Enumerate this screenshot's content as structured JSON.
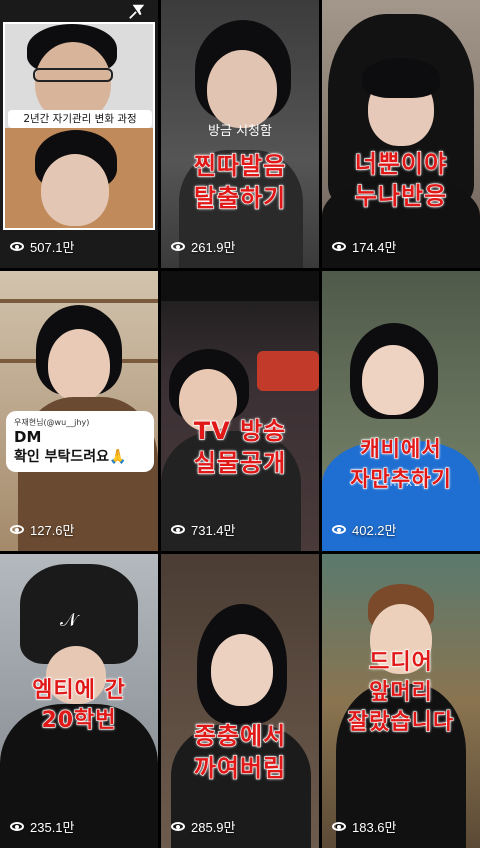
{
  "tiles": [
    {
      "views": "507.1만",
      "label": "2년간 자기관리 변화 과정",
      "bg": "#c9c9c9"
    },
    {
      "views": "261.9만",
      "subtitle": "방금 시청함",
      "line1": "찐따발음",
      "line2": "탈출하기",
      "bg": "#4a4a4a"
    },
    {
      "views": "174.4만",
      "line1": "너뿐이야",
      "line2": "누나반응",
      "bg": "#8c7d70"
    },
    {
      "views": "127.6만",
      "comment_user": "우재현님(@wu__jhy)",
      "comment_line1": "DM",
      "comment_line2": "확인 부탁드려요🙏",
      "bg": "#b7a590"
    },
    {
      "views": "731.4만",
      "line1": "TV 방송",
      "line2": "실물공개",
      "bg": "#3a3034"
    },
    {
      "views": "402.2만",
      "line1": "캐비에서",
      "line2": "자만추하기",
      "bg": "#6b7d63"
    },
    {
      "views": "235.1만",
      "line1": "엠티에 간",
      "line2": "20학번",
      "bg": "#9aa0a6"
    },
    {
      "views": "285.9만",
      "line1": "종충에서",
      "line2": "까여버림",
      "bg": "#5d4f45"
    },
    {
      "views": "183.6만",
      "line1": "드디어",
      "line2": "앞머리",
      "line3": "잘랐습니다",
      "bg": "#7a6a52"
    }
  ],
  "icons": {
    "pin": "pin-icon",
    "views": "eye-icon"
  }
}
